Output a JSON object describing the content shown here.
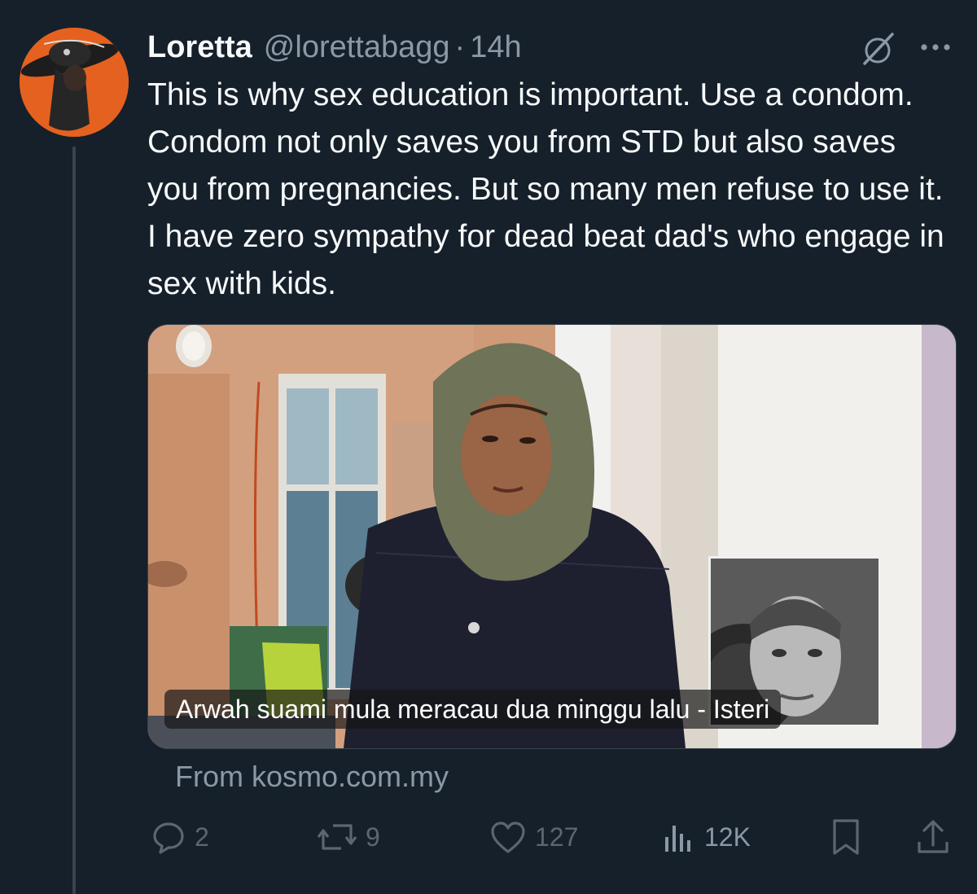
{
  "tweet": {
    "display_name": "Loretta",
    "handle": "@lorettabagg",
    "separator": "·",
    "time": "14h",
    "text": "This is why sex education is important. Use a condom. Condom not only saves you from STD but also saves you from pregnancies. But so many men refuse to use it. I have zero sympathy for dead beat dad's who engage in sex with kids."
  },
  "media": {
    "caption": "Arwah suami mula meracau dua minggu lalu - Isteri",
    "source": "From kosmo.com.my"
  },
  "actions": {
    "replies": "2",
    "reposts": "9",
    "likes": "127",
    "views": "12K"
  },
  "colors": {
    "background": "#15202b",
    "text_primary": "#f7f9f9",
    "text_secondary": "#8b98a5",
    "avatar_accent": "#e5611f"
  },
  "icons": [
    "grok-icon",
    "more-icon",
    "reply-icon",
    "repost-icon",
    "like-icon",
    "views-icon",
    "bookmark-icon",
    "share-icon"
  ]
}
